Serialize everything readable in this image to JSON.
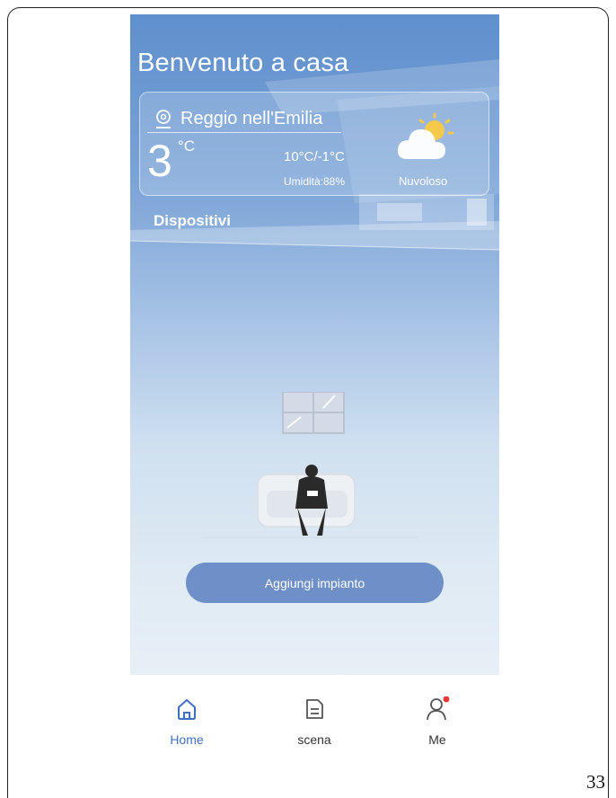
{
  "header": {
    "welcome": "Benvenuto a casa"
  },
  "weather": {
    "city": "Reggio nell'Emilia",
    "temperature": "3",
    "unit": "°C",
    "range": "10°C/-1°C",
    "humidity": "Umidità:88%",
    "condition": "Nuvoloso",
    "icon": "partly-cloudy-icon"
  },
  "devices": {
    "section_title": "Dispositivi",
    "add_button": "Aggiungi impianto"
  },
  "nav": {
    "items": [
      {
        "label": "Home",
        "icon": "home-icon",
        "active": true
      },
      {
        "label": "scena",
        "icon": "scene-icon",
        "active": false
      },
      {
        "label": "Me",
        "icon": "user-icon",
        "active": false,
        "badge": true
      }
    ]
  },
  "page": {
    "number": "33"
  },
  "colors": {
    "accent": "#3f6fbf",
    "button": "#6e8fc8",
    "badge": "#e53935"
  }
}
